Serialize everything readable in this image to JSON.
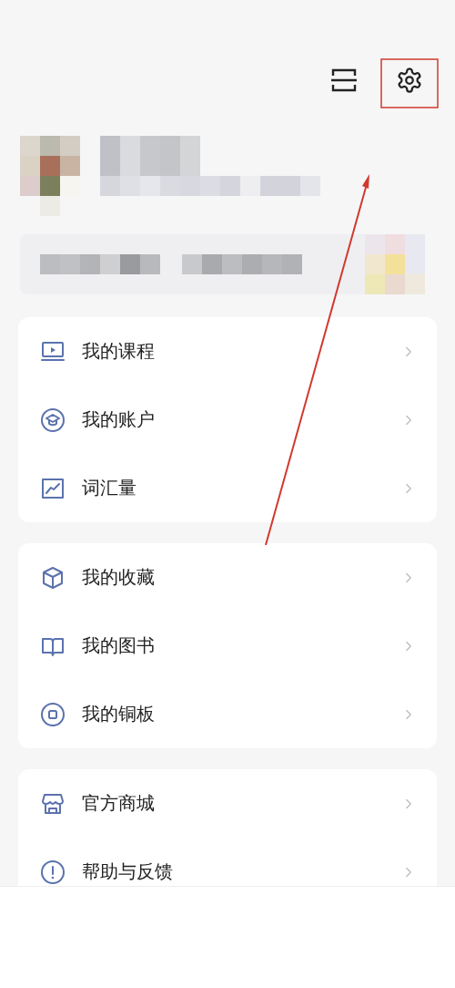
{
  "menu_groups": [
    {
      "items": [
        {
          "label": "我的课程"
        },
        {
          "label": "我的账户"
        },
        {
          "label": "词汇量"
        }
      ]
    },
    {
      "items": [
        {
          "label": "我的收藏"
        },
        {
          "label": "我的图书"
        },
        {
          "label": "我的铜板"
        }
      ]
    },
    {
      "items": [
        {
          "label": "官方商城"
        },
        {
          "label": "帮助与反馈"
        }
      ]
    }
  ]
}
